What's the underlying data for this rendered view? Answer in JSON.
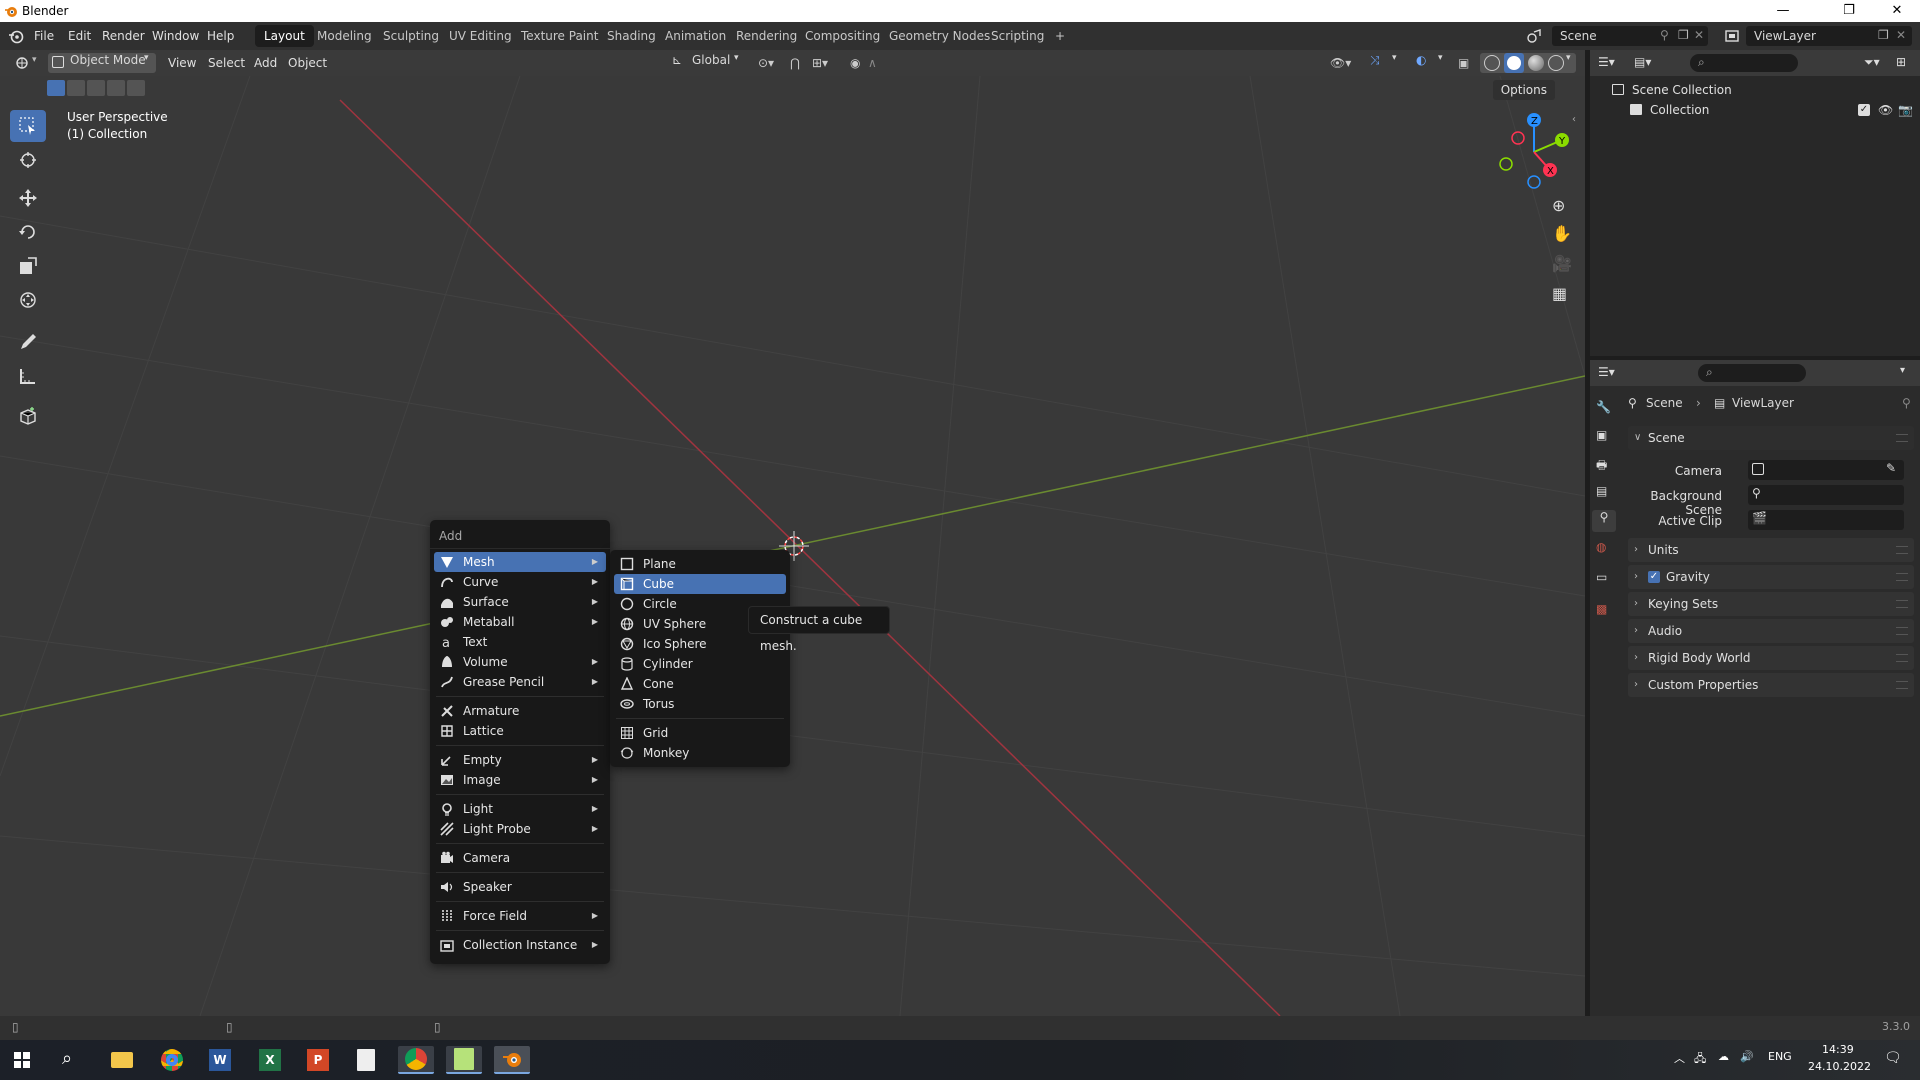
{
  "window": {
    "title": "Blender",
    "controls": [
      "—",
      "❐",
      "✕"
    ]
  },
  "menubar": {
    "items": [
      "File",
      "Edit",
      "Render",
      "Window",
      "Help"
    ],
    "workspaces": [
      "Layout",
      "Modeling",
      "Sculpting",
      "UV Editing",
      "Texture Paint",
      "Shading",
      "Animation",
      "Rendering",
      "Compositing",
      "Geometry Nodes",
      "Scripting",
      "+"
    ],
    "active_workspace": "Layout",
    "scene": "Scene",
    "view_layer": "ViewLayer"
  },
  "viewport_header": {
    "mode": "Object Mode",
    "menus": [
      "View",
      "Select",
      "Add",
      "Object"
    ],
    "transform_orientation": "Global",
    "options_label": "Options"
  },
  "viewport": {
    "perspective_label": "User Perspective",
    "collection_label": "(1) Collection",
    "gizmo_axes": [
      "Z",
      "Y",
      "X"
    ]
  },
  "add_menu": {
    "title": "Add",
    "items": [
      {
        "label": "Mesh",
        "icon": "mesh-icon",
        "submenu": true,
        "highlighted": true
      },
      {
        "label": "Curve",
        "icon": "curve-icon",
        "submenu": true
      },
      {
        "label": "Surface",
        "icon": "surface-icon",
        "submenu": true
      },
      {
        "label": "Metaball",
        "icon": "metaball-icon",
        "submenu": true
      },
      {
        "label": "Text",
        "icon": "text-icon",
        "submenu": false
      },
      {
        "label": "Volume",
        "icon": "volume-icon",
        "submenu": true
      },
      {
        "label": "Grease Pencil",
        "icon": "grease-pencil-icon",
        "submenu": true
      },
      {
        "label": "Armature",
        "icon": "armature-icon",
        "submenu": false
      },
      {
        "label": "Lattice",
        "icon": "lattice-icon",
        "submenu": false
      },
      {
        "label": "Empty",
        "icon": "empty-icon",
        "submenu": true
      },
      {
        "label": "Image",
        "icon": "image-icon",
        "submenu": true
      },
      {
        "label": "Light",
        "icon": "light-icon",
        "submenu": true
      },
      {
        "label": "Light Probe",
        "icon": "light-probe-icon",
        "submenu": true
      },
      {
        "label": "Camera",
        "icon": "camera-icon",
        "submenu": false
      },
      {
        "label": "Speaker",
        "icon": "speaker-icon",
        "submenu": false
      },
      {
        "label": "Force Field",
        "icon": "force-field-icon",
        "submenu": true
      },
      {
        "label": "Collection Instance",
        "icon": "collection-instance-icon",
        "submenu": true
      }
    ]
  },
  "mesh_submenu": {
    "items": [
      {
        "label": "Plane",
        "icon": "plane-icon"
      },
      {
        "label": "Cube",
        "icon": "cube-icon",
        "highlighted": true
      },
      {
        "label": "Circle",
        "icon": "circle-icon"
      },
      {
        "label": "UV Sphere",
        "icon": "uv-sphere-icon"
      },
      {
        "label": "Ico Sphere",
        "icon": "ico-sphere-icon"
      },
      {
        "label": "Cylinder",
        "icon": "cylinder-icon"
      },
      {
        "label": "Cone",
        "icon": "cone-icon"
      },
      {
        "label": "Torus",
        "icon": "torus-icon"
      },
      {
        "label": "Grid",
        "icon": "grid-icon"
      },
      {
        "label": "Monkey",
        "icon": "monkey-icon"
      }
    ],
    "tooltip": "Construct a cube mesh."
  },
  "outliner": {
    "rows": [
      {
        "label": "Scene Collection"
      },
      {
        "label": "Collection"
      }
    ]
  },
  "properties": {
    "breadcrumb": [
      "Scene",
      "ViewLayer"
    ],
    "scene_panel_title": "Scene",
    "fields": [
      {
        "label": "Camera"
      },
      {
        "label": "Background Scene"
      },
      {
        "label": "Active Clip"
      }
    ],
    "panels": [
      {
        "label": "Units",
        "checkbox": false
      },
      {
        "label": "Gravity",
        "checkbox": true
      },
      {
        "label": "Keying Sets",
        "checkbox": false
      },
      {
        "label": "Audio",
        "checkbox": false
      },
      {
        "label": "Rigid Body World",
        "checkbox": false
      },
      {
        "label": "Custom Properties",
        "checkbox": false
      }
    ]
  },
  "statusbar": {
    "version": "3.3.0"
  },
  "taskbar": {
    "language": "ENG",
    "time": "14:39",
    "date": "24.10.2022"
  },
  "colors": {
    "accent": "#4772b3",
    "x_axis": "#ff3352",
    "y_axis": "#8bdc00",
    "z_axis": "#2890ff"
  }
}
